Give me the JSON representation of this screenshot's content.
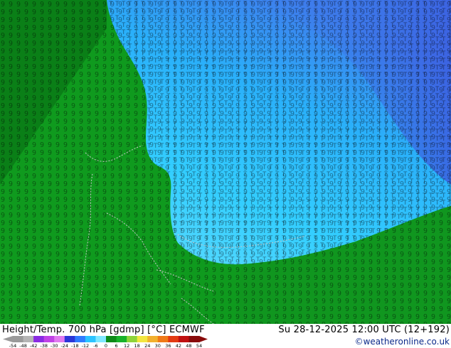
{
  "map": {
    "model": "ECMWF",
    "level": "700 hPa",
    "parameter": "Height/Temp.",
    "units": "[gdmp] [°C]",
    "colors": {
      "land_green_dark": "#0a7a14",
      "land_green": "#0f9a1e",
      "sea_cyan": "#22c8ff",
      "sea_light": "#5cd8ff",
      "sea_blue": "#3f8cf0",
      "sea_deep_blue": "#3a5fe0",
      "border_gray": "#b9b9b9"
    }
  },
  "footer": {
    "title_left": "Height/Temp. 700 hPa [gdmp] [°C] ECMWF",
    "title_right": "Su 28-12-2025 12:00 UTC (12+192)",
    "credit": "©weatheronline.co.uk",
    "colorbar": {
      "ticks": [
        "-54",
        "-48",
        "-42",
        "-38",
        "-30",
        "-24",
        "-18",
        "-12",
        "-6",
        "0",
        "6",
        "12",
        "18",
        "24",
        "30",
        "36",
        "42",
        "48",
        "54"
      ],
      "colors": [
        "#9a9a9a",
        "#b4b4b4",
        "#8a2be2",
        "#c043e6",
        "#e07af0",
        "#2a36d8",
        "#2f7bff",
        "#2cc4ff",
        "#7fe8ff",
        "#0c8a18",
        "#18b22a",
        "#8ed43a",
        "#f2e640",
        "#f2b12e",
        "#f07a18",
        "#e33a12",
        "#c01010",
        "#880a0a"
      ]
    }
  }
}
